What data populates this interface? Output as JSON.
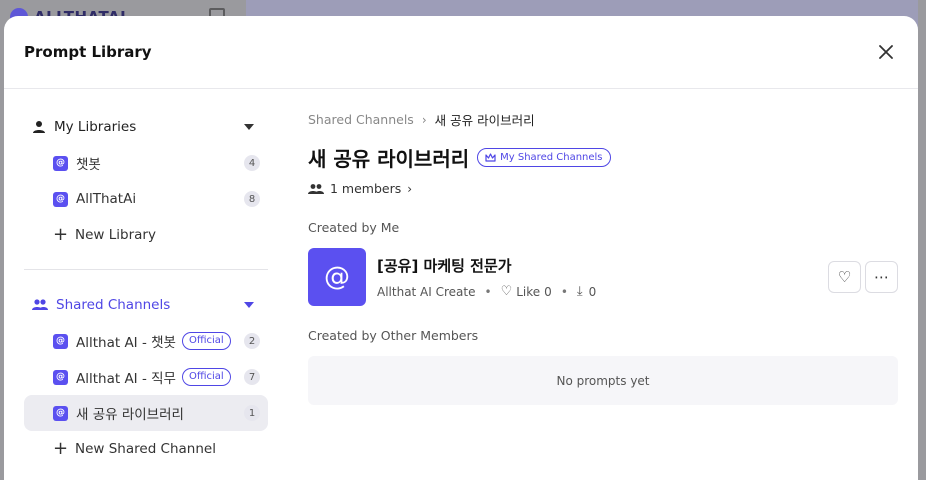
{
  "background": {
    "logo_text": "ALLTHATAI"
  },
  "modal": {
    "title": "Prompt Library"
  },
  "sidebar": {
    "my_libraries": {
      "label": "My Libraries",
      "items": [
        {
          "label": "챗봇",
          "count": "4"
        },
        {
          "label": "AllThatAi",
          "count": "8"
        }
      ],
      "new_label": "New Library"
    },
    "shared_channels": {
      "label": "Shared Channels",
      "items": [
        {
          "label": "Allthat AI - 챗봇",
          "badge": "Official",
          "count": "2"
        },
        {
          "label": "Allthat AI - 직무",
          "badge": "Official",
          "count": "7"
        },
        {
          "label": "새 공유 라이브러리",
          "count": "1"
        }
      ],
      "new_label": "New Shared Channel"
    }
  },
  "main": {
    "breadcrumb": {
      "parent": "Shared Channels",
      "current": "새 공유 라이브러리"
    },
    "title": "새 공유 라이브러리",
    "chip_label": "My Shared Channels",
    "members": "1 members",
    "created_by_me_label": "Created by Me",
    "prompt": {
      "title": "[공유] 마케팅 전문가",
      "author": "Allthat AI Create",
      "like_label": "Like",
      "like_count": "0",
      "download_count": "0"
    },
    "created_by_others_label": "Created by Other Members",
    "empty_text": "No prompts yet"
  },
  "colors": {
    "accent": "#4f46e5",
    "icon_bg": "#5b50f0"
  }
}
